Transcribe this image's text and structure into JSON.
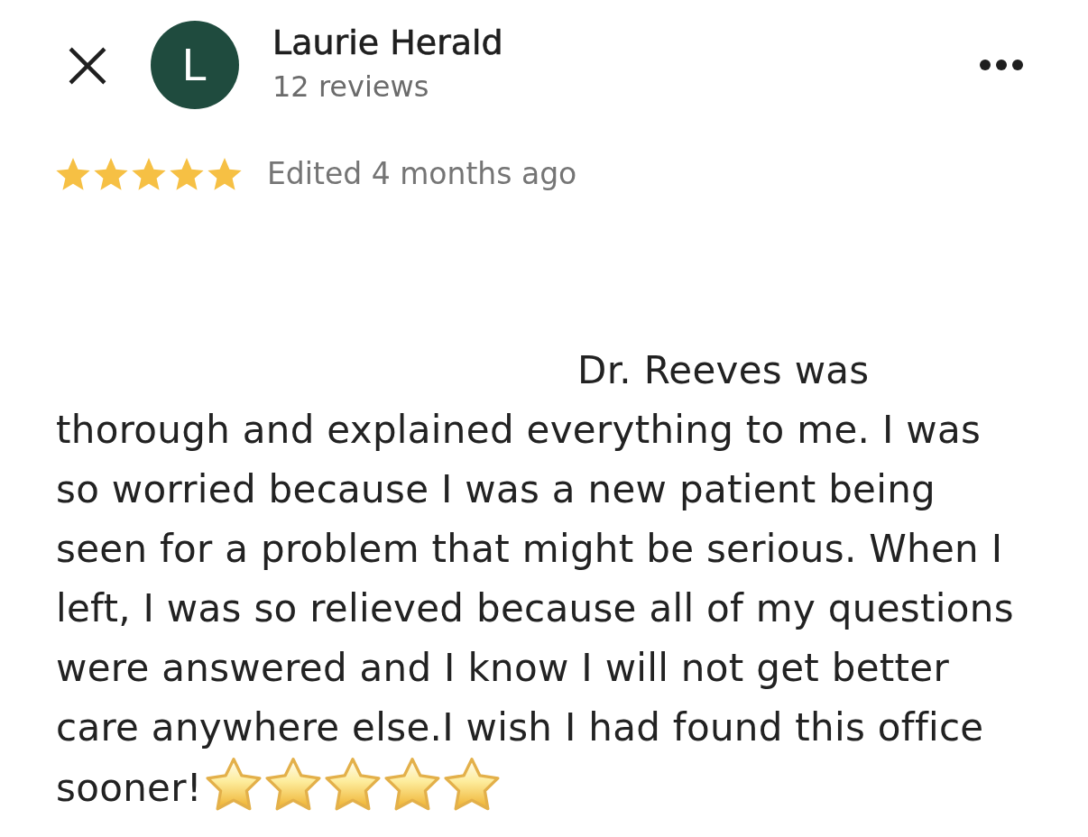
{
  "reviewer": {
    "initial": "L",
    "name": "Laurie Herald",
    "reviews": "12 reviews"
  },
  "rating": {
    "stars": 5,
    "edited": "Edited 4 months ago"
  },
  "review": {
    "lines": [
      "Dr. Reeves was",
      "thorough and explained everything to me. I was",
      "so worried because I was a new patient being",
      "seen for a problem that might be serious. When I",
      "left, I was so relieved because all of my questions",
      "were answered and I know I will not get better",
      "care anywhere else.I wish I had found this office",
      "sooner!"
    ],
    "emojis": [
      {
        "kind": "star"
      },
      {
        "kind": "star"
      },
      {
        "kind": "star"
      },
      {
        "kind": "star"
      },
      {
        "kind": "star"
      }
    ]
  }
}
